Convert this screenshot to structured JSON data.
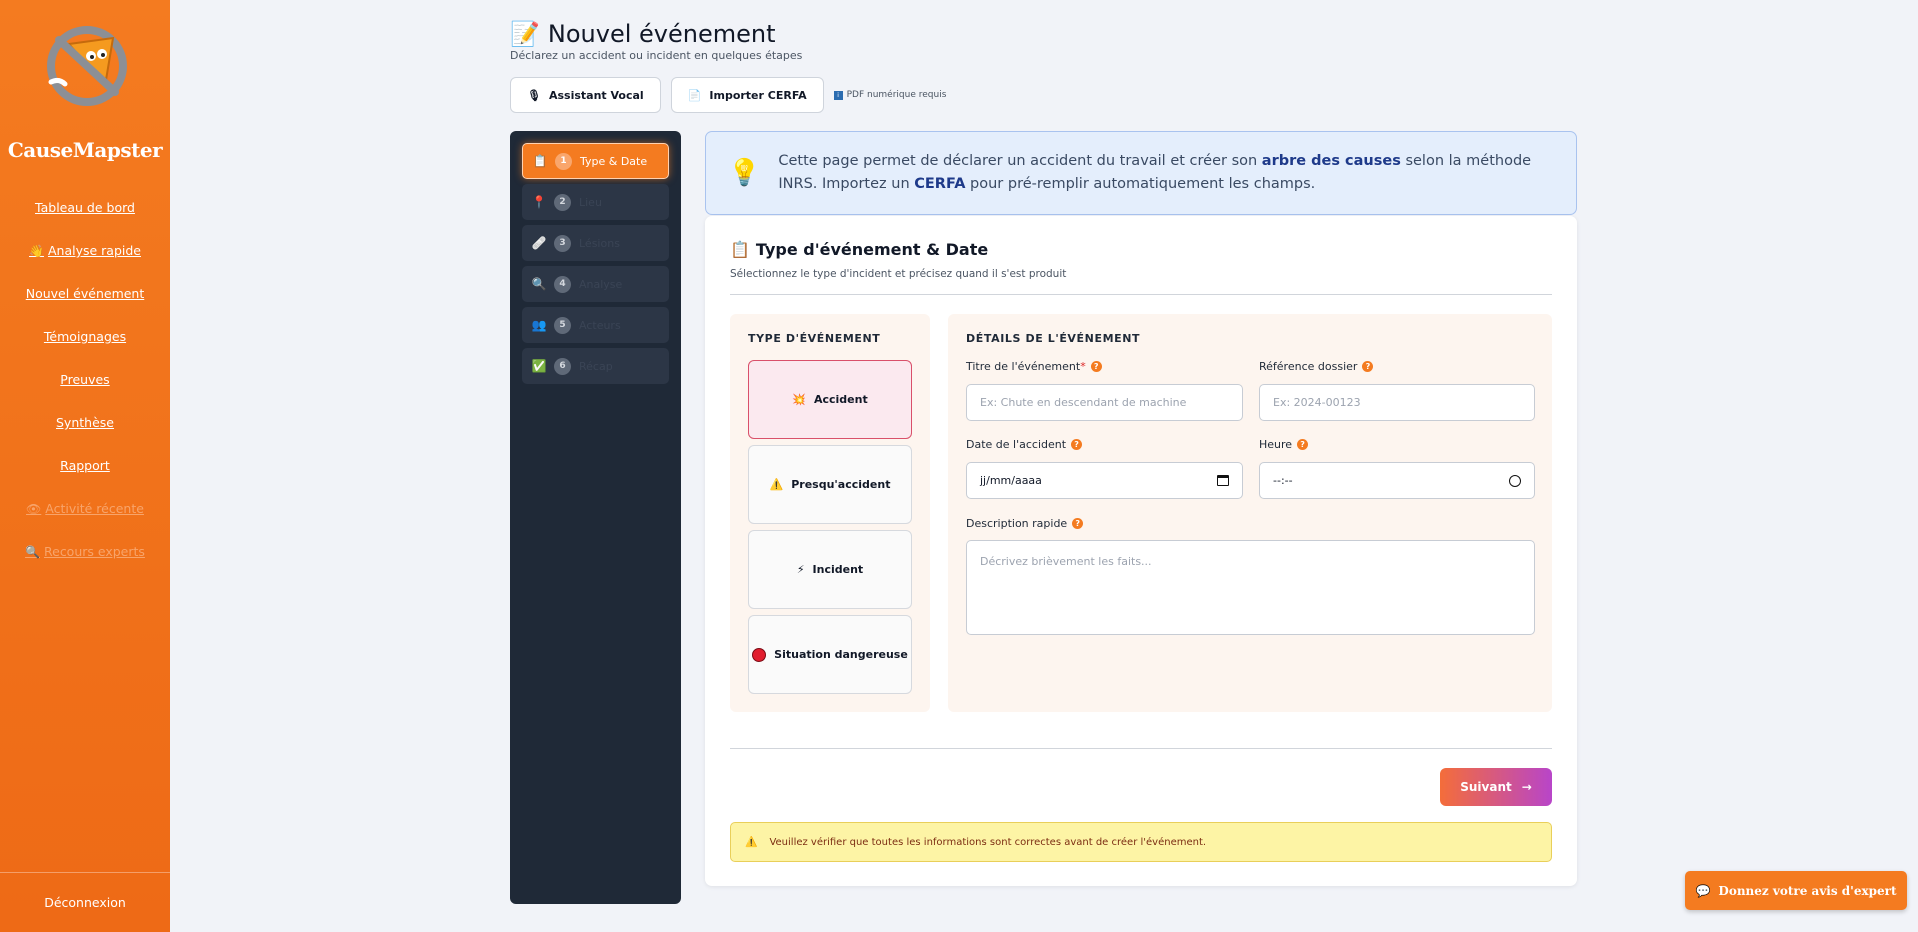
{
  "app": {
    "brand": "CauseMapster"
  },
  "sidebar": {
    "items": [
      {
        "label": "Tableau de bord",
        "icon": ""
      },
      {
        "label": "Analyse rapide",
        "icon": "hand-wave-icon"
      },
      {
        "label": "Nouvel événement",
        "icon": ""
      },
      {
        "label": "Témoignages",
        "icon": ""
      },
      {
        "label": "Preuves",
        "icon": ""
      },
      {
        "label": "Synthèse",
        "icon": ""
      },
      {
        "label": "Rapport",
        "icon": ""
      },
      {
        "label": "Activité récente",
        "icon": "eye-icon"
      },
      {
        "label": "Recours experts",
        "icon": "magnifier-icon"
      }
    ],
    "logout": "Déconnexion"
  },
  "header": {
    "title": "Nouvel événement",
    "subtitle": "Déclarez un accident ou incident en quelques étapes"
  },
  "actions": {
    "voice": "Assistant Vocal",
    "cerfa": "Importer CERFA",
    "pdf_note": "PDF numérique requis"
  },
  "steps": [
    {
      "num": "1",
      "label": "Type & Date",
      "active": true
    },
    {
      "num": "2",
      "label": "Lieu"
    },
    {
      "num": "3",
      "label": "Lésions"
    },
    {
      "num": "4",
      "label": "Analyse"
    },
    {
      "num": "5",
      "label": "Acteurs"
    },
    {
      "num": "6",
      "label": "Récap"
    }
  ],
  "info": {
    "part1": "Cette page permet de déclarer un accident du travail et créer son ",
    "bold1": "arbre des causes",
    "part2": " selon la méthode INRS. Importez un ",
    "bold2": "CERFA",
    "part3": " pour pré-remplir automatiquement les champs."
  },
  "section": {
    "title": "Type d'événement & Date",
    "subtitle": "Sélectionnez le type d'incident et précisez quand il s'est produit"
  },
  "type_box": {
    "heading": "TYPE D'ÉVÉNEMENT",
    "options": [
      {
        "label": "Accident",
        "icon": "collision-icon",
        "selected": true
      },
      {
        "label": "Presqu'accident",
        "icon": "warning-icon"
      },
      {
        "label": "Incident",
        "icon": "lightning-icon"
      },
      {
        "label": "Situation dangereuse",
        "icon": "red-circle-icon"
      }
    ]
  },
  "details": {
    "heading": "DÉTAILS DE L'ÉVÉNEMENT",
    "title_label": "Titre de l'événement",
    "title_required": "*",
    "title_placeholder": "Ex: Chute en descendant de machine",
    "ref_label": "Référence dossier",
    "ref_placeholder": "Ex: 2024-00123",
    "date_label": "Date de l'accident",
    "date_value": "jj/mm/aaaa",
    "time_label": "Heure",
    "time_value": "--:--",
    "desc_label": "Description rapide",
    "desc_placeholder": "Décrivez brièvement les faits..."
  },
  "next_button": "Suivant",
  "warning": "Veuillez vérifier que toutes les informations sont correctes avant de créer l'événement.",
  "feedback": "Donnez votre avis d'expert",
  "colors": {
    "accent": "#f47b20",
    "sidebar": "#ee6a16",
    "steps_bg": "#1f2937"
  }
}
